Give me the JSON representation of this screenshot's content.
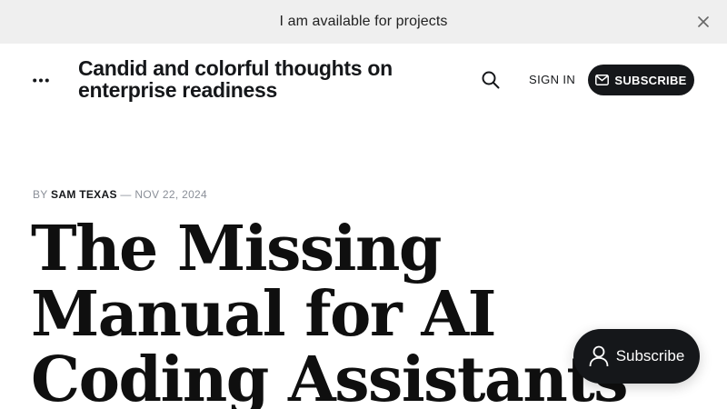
{
  "announcement": {
    "text": "I am available for projects",
    "close_icon": "close-icon"
  },
  "header": {
    "site_title": "Candid and colorful thoughts on enterprise readiness",
    "sign_in_label": "SIGN IN",
    "subscribe_label": "SUBSCRIBE"
  },
  "article": {
    "by_label": "BY",
    "author": "SAM TEXAS",
    "separator": "—",
    "date": "NOV 22, 2024",
    "title": "The Missing Manual for AI Coding Assistants"
  },
  "portal": {
    "label": "Subscribe"
  },
  "colors": {
    "accent": "#15171a",
    "announcement_bg": "#efefef",
    "meta_gray": "#8a8f98"
  }
}
